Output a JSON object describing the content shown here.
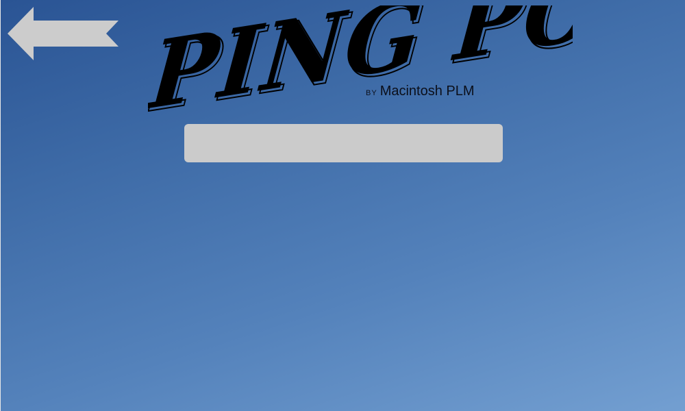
{
  "title": {
    "text": "PING PONG",
    "fill": "#000000",
    "outline": "#000000"
  },
  "byline": {
    "by": "BY",
    "author": "Macintosh PLM"
  },
  "input": {
    "value": "",
    "placeholder": ""
  },
  "back_button": {
    "icon": "back-arrow-icon",
    "color": "#cccccc"
  },
  "colors": {
    "background_top": "#2a5494",
    "background_bottom": "#739fd1",
    "input_bg": "#cbcbcb"
  }
}
